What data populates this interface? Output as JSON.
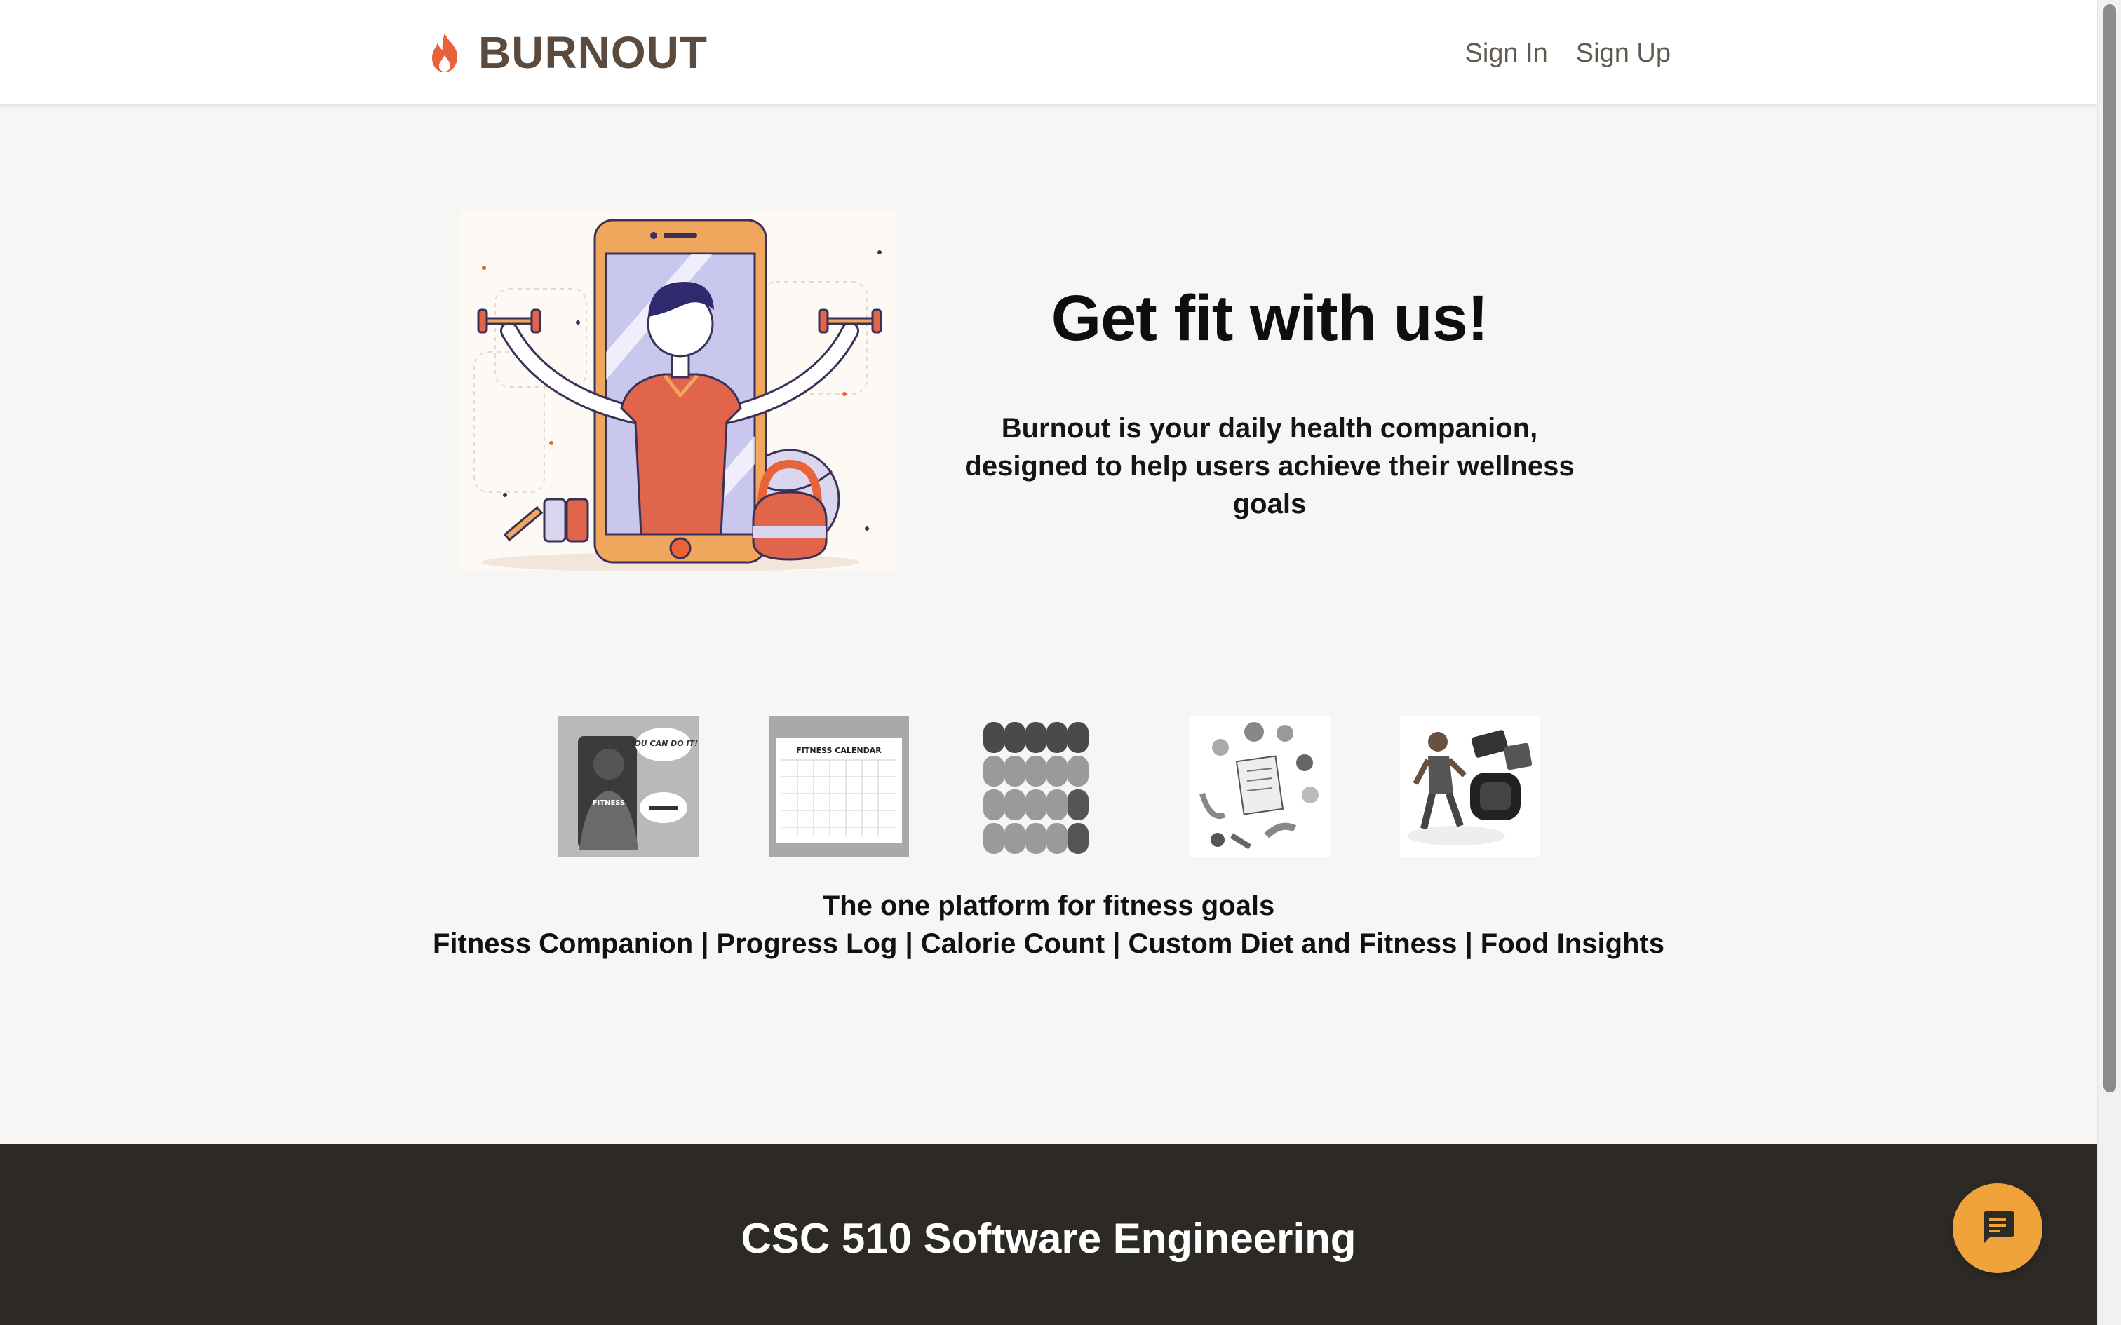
{
  "header": {
    "brand_name": "BURNOUT",
    "brand_icon": "flame-icon",
    "nav": [
      {
        "label": "Sign In"
      },
      {
        "label": "Sign Up"
      }
    ]
  },
  "hero": {
    "title": "Get fit with us!",
    "description": "Burnout is your daily health companion, designed to help users achieve their wellness goals",
    "image": "fitness-phone-illustration"
  },
  "features": {
    "images": [
      {
        "name": "fitness-companion-image",
        "text": [
          "YOU CAN DO IT!",
          "FITNESS"
        ]
      },
      {
        "name": "progress-log-image",
        "text": [
          "FITNESS CALENDAR"
        ]
      },
      {
        "name": "calorie-count-image",
        "text": []
      },
      {
        "name": "custom-diet-image",
        "text": []
      },
      {
        "name": "food-insights-image",
        "text": []
      }
    ],
    "tagline": "The one platform for fitness goals",
    "list": "Fitness Companion | Progress Log | Calorie Count | Custom Diet and Fitness | Food Insights"
  },
  "footer": {
    "title": "CSC 510 Software Engineering"
  },
  "chat": {
    "icon": "chat-icon"
  },
  "colors": {
    "brand": "#5a4b3e",
    "flame": "#e8623a",
    "footer_bg": "#2d2a26",
    "chat_bg": "#f0a33a",
    "page_bg": "#f7f6f4"
  }
}
